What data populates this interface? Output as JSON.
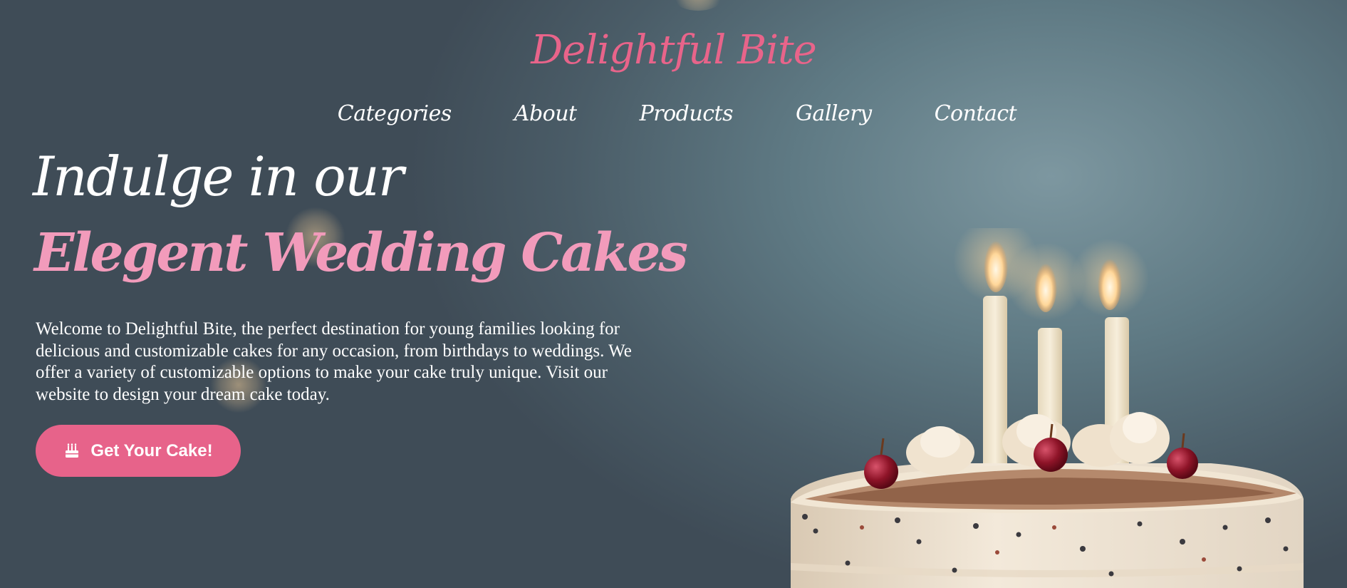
{
  "brand": {
    "name": "Delightful Bite",
    "color": "#e8648a"
  },
  "nav": {
    "items": [
      {
        "label": "Categories"
      },
      {
        "label": "About"
      },
      {
        "label": "Products"
      },
      {
        "label": "Gallery"
      },
      {
        "label": "Contact"
      }
    ]
  },
  "hero": {
    "line1": "Indulge in our",
    "line2": "Elegent Wedding Cakes",
    "intro": "Welcome to Delightful Bite, the perfect destination for young families looking for delicious and customizable cakes for any occasion, from birthdays to weddings. We offer a variety of customizable options to make your cake truly unique. Visit our website to design your dream cake today.",
    "accent_color": "#f29bbb"
  },
  "cta": {
    "label": "Get Your Cake!",
    "icon": "birthday-cake-icon",
    "color": "#e7638a"
  },
  "background": {
    "image": "birthday-cake-with-candles",
    "color": "#5f7a84"
  }
}
